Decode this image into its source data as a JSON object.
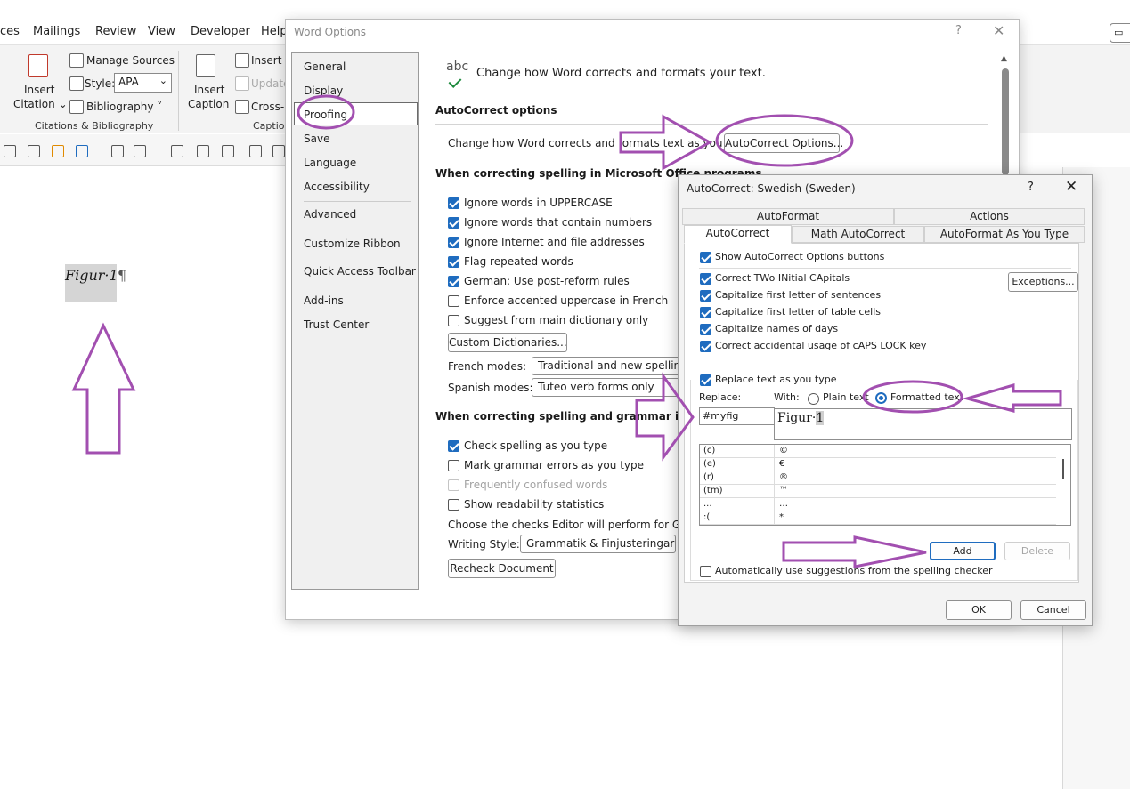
{
  "ribbon": {
    "tabs": [
      "ces",
      "Mailings",
      "Review",
      "View",
      "Developer",
      "Help"
    ],
    "insert_citation": [
      "Insert",
      "Citation ⌄"
    ],
    "manage_sources": "Manage Sources",
    "style_label": "Style:",
    "style_value": "APA",
    "bibliography": "Bibliography ˅",
    "group_citations": "Citations & Bibliography",
    "insert_caption": [
      "Insert",
      "Caption"
    ],
    "insert_tof": "Insert T",
    "update": "Update",
    "cross_ref": "Cross-r",
    "group_captions": "Captio"
  },
  "document": {
    "text": "Figur·1",
    "pilcrow": "¶"
  },
  "word_options": {
    "title": "Word Options",
    "help": "?",
    "close": "✕",
    "nav": [
      "General",
      "Display",
      "Proofing",
      "Save",
      "Language",
      "Accessibility",
      "Advanced",
      "Customize Ribbon",
      "Quick Access Toolbar",
      "Add-ins",
      "Trust Center"
    ],
    "header_icon_text": "abc",
    "header": "Change how Word corrects and formats your text.",
    "autocorrect_heading": "AutoCorrect options",
    "autocorrect_desc": "Change how Word corrects and formats text as you type:",
    "autocorrect_button": "AutoCorrect Options...",
    "spelling_heading": "When correcting spelling in Microsoft Office programs",
    "spelling_options": [
      {
        "label": "Ignore words in UPPERCASE",
        "checked": true
      },
      {
        "label": "Ignore words that contain numbers",
        "checked": true
      },
      {
        "label": "Ignore Internet and file addresses",
        "checked": true
      },
      {
        "label": "Flag repeated words",
        "checked": true
      },
      {
        "label": "German: Use post-reform rules",
        "checked": true
      },
      {
        "label": "Enforce accented uppercase in French",
        "checked": false
      },
      {
        "label": "Suggest from main dictionary only",
        "checked": false
      }
    ],
    "custom_dictionaries": "Custom Dictionaries...",
    "french_label": "French modes:",
    "french_value": "Traditional and new spellings",
    "spanish_label": "Spanish modes:",
    "spanish_value": "Tuteo verb forms only",
    "grammar_heading": "When correcting spelling and grammar in Word",
    "grammar_options": [
      {
        "label": "Check spelling as you type",
        "checked": true,
        "disabled": false
      },
      {
        "label": "Mark grammar errors as you type",
        "checked": false,
        "disabled": false
      },
      {
        "label": "Frequently confused words",
        "checked": false,
        "disabled": true
      },
      {
        "label": "Show readability statistics",
        "checked": false,
        "disabled": false
      }
    ],
    "editor_checks": "Choose the checks Editor will perform for Gramm",
    "writing_style_label": "Writing Style:",
    "writing_style_value": "Grammatik & Finjusteringar",
    "recheck_button": "Recheck Document"
  },
  "autocorrect": {
    "title": "AutoCorrect: Swedish (Sweden)",
    "help": "?",
    "close": "✕",
    "tabs_row1": [
      "AutoFormat",
      "Actions"
    ],
    "tabs_row2": [
      "AutoCorrect",
      "Math AutoCorrect",
      "AutoFormat As You Type"
    ],
    "show_buttons": "Show AutoCorrect Options buttons",
    "options": [
      "Correct TWo INitial CApitals",
      "Capitalize first letter of sentences",
      "Capitalize first letter of table cells",
      "Capitalize names of days",
      "Correct accidental usage of cAPS LOCK key"
    ],
    "exceptions_button": "Exceptions...",
    "replace_as_type": "Replace text as you type",
    "replace_label": "Replace:",
    "with_label": "With:",
    "plain_text": "Plain text",
    "formatted_text": "Formatted text",
    "replace_value": "#myfig",
    "with_value_a": "Figur·",
    "with_value_b": "1",
    "entries": [
      {
        "from": "(c)",
        "to": "©"
      },
      {
        "from": "(e)",
        "to": "€"
      },
      {
        "from": "(r)",
        "to": "®"
      },
      {
        "from": "(tm)",
        "to": "™"
      },
      {
        "from": "...",
        "to": "…"
      },
      {
        "from": ":(",
        "to": "*"
      }
    ],
    "add_button": "Add",
    "delete_button": "Delete",
    "auto_suggest": "Automatically use suggestions from the spelling checker",
    "ok_button": "OK",
    "cancel_button": "Cancel"
  },
  "colors": {
    "annotation": "#a24fb0",
    "accent": "#1f6cbf"
  }
}
